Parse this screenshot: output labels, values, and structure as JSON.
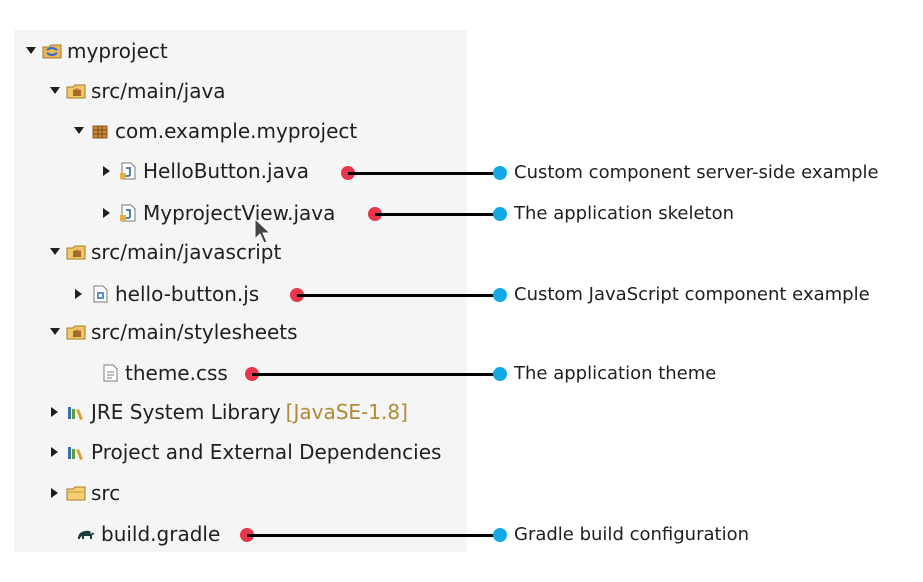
{
  "tree": {
    "items": [
      {
        "label": "myproject",
        "icon": "project-icon",
        "expanded": true
      },
      {
        "label": "src/main/java",
        "icon": "source-folder-icon",
        "expanded": true
      },
      {
        "label": "com.example.myproject",
        "icon": "package-icon",
        "expanded": true
      },
      {
        "label": "HelloButton.java",
        "icon": "java-file-icon",
        "expanded": false
      },
      {
        "label": "MyprojectView.java",
        "icon": "java-file-icon",
        "expanded": false
      },
      {
        "label": "src/main/javascript",
        "icon": "source-folder-icon",
        "expanded": true
      },
      {
        "label": "hello-button.js",
        "icon": "js-file-icon",
        "expanded": false
      },
      {
        "label": "src/main/stylesheets",
        "icon": "source-folder-icon",
        "expanded": true
      },
      {
        "label": "theme.css",
        "icon": "css-file-icon",
        "expanded": null
      },
      {
        "label": "JRE System Library",
        "decoration": "[JavaSE-1.8]",
        "icon": "library-icon",
        "expanded": false
      },
      {
        "label": "Project and External Dependencies",
        "icon": "library-icon",
        "expanded": false
      },
      {
        "label": "src",
        "icon": "folder-icon",
        "expanded": false
      },
      {
        "label": "build.gradle",
        "icon": "gradle-elephant-icon",
        "expanded": null
      }
    ]
  },
  "callouts": [
    {
      "text": "Custom component server-side example"
    },
    {
      "text": "The application skeleton"
    },
    {
      "text": "Custom JavaScript component example"
    },
    {
      "text": "The application theme"
    },
    {
      "text": "Gradle build configuration"
    }
  ],
  "colors": {
    "marker_red": "#e8374b",
    "marker_blue": "#14a9e6",
    "connector": "#000000",
    "decoration_text": "#b08a37"
  }
}
